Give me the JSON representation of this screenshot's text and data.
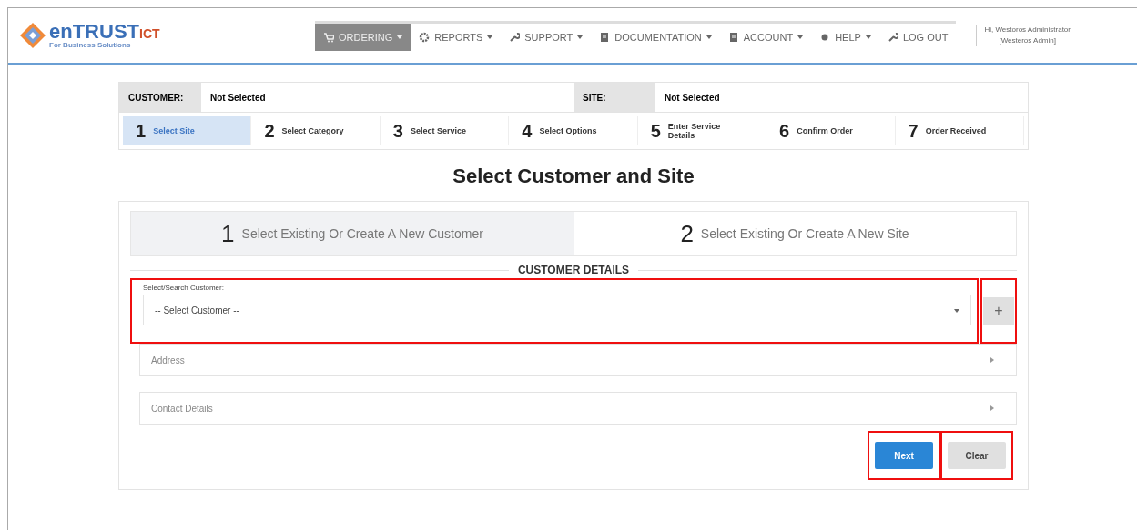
{
  "logo": {
    "name": "enTRUST",
    "suffix": "ICT",
    "tagline": "For Business Solutions"
  },
  "nav": [
    {
      "label": "ORDERING",
      "kind": "cart",
      "dropdown": true,
      "selected": true
    },
    {
      "label": "REPORTS",
      "kind": "gear",
      "dropdown": true,
      "selected": false
    },
    {
      "label": "SUPPORT",
      "kind": "wrench",
      "dropdown": true,
      "selected": false
    },
    {
      "label": "DOCUMENTATION",
      "kind": "book",
      "dropdown": true,
      "selected": false
    },
    {
      "label": "ACCOUNT",
      "kind": "book",
      "dropdown": true,
      "selected": false
    },
    {
      "label": "HELP",
      "kind": "dot",
      "dropdown": true,
      "selected": false
    },
    {
      "label": "LOG OUT",
      "kind": "wrench",
      "dropdown": false,
      "selected": false
    }
  ],
  "user": {
    "greeting": "Hi, Westoros Administrator",
    "role": "[Westeros Admin]"
  },
  "summary": [
    {
      "label": "CUSTOMER:",
      "value": "Not Selected"
    },
    {
      "label": "SITE:",
      "value": "Not Selected"
    }
  ],
  "steps": [
    {
      "number": "1",
      "label": "Select Site",
      "selected": true
    },
    {
      "number": "2",
      "label": "Select Category",
      "selected": false
    },
    {
      "number": "3",
      "label": "Select Service",
      "selected": false
    },
    {
      "number": "4",
      "label": "Select Options",
      "selected": false
    },
    {
      "number": "5",
      "label": "Enter Service Details",
      "selected": false
    },
    {
      "number": "6",
      "label": "Confirm Order",
      "selected": false
    },
    {
      "number": "7",
      "label": "Order Received",
      "selected": false
    }
  ],
  "page_title": "Select Customer and Site",
  "substeps": [
    {
      "number": "1",
      "label": "Select Existing Or Create A New Customer",
      "selected": true
    },
    {
      "number": "2",
      "label": "Select Existing Or Create A New Site",
      "selected": false
    }
  ],
  "section_title": "CUSTOMER DETAILS",
  "customer_field": {
    "label": "Select/Search Customer:",
    "value": "-- Select Customer --",
    "highlighted": true
  },
  "add_button": {
    "label": "+",
    "highlighted": true
  },
  "panels": [
    {
      "label": "Address"
    },
    {
      "label": "Contact Details"
    }
  ],
  "buttons": [
    {
      "label": "Next",
      "kind": "primary",
      "highlighted": true
    },
    {
      "label": "Clear",
      "kind": "secondary",
      "highlighted": true
    }
  ]
}
